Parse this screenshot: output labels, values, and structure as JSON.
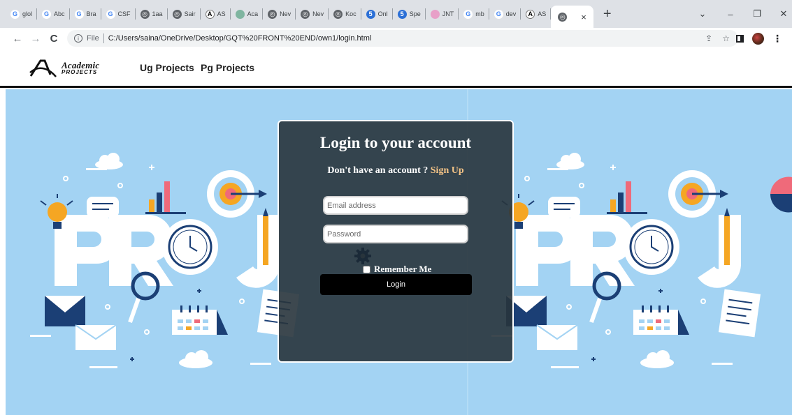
{
  "browser": {
    "tabs": [
      {
        "label": "glol",
        "icon": "google-icon"
      },
      {
        "label": "Abc",
        "icon": "google-icon"
      },
      {
        "label": "Bra",
        "icon": "google-icon"
      },
      {
        "label": "CSF",
        "icon": "google-icon"
      },
      {
        "label": "1aa",
        "icon": "globe-icon"
      },
      {
        "label": "Sair",
        "icon": "globe-icon"
      },
      {
        "label": "AS",
        "icon": "site-a-icon"
      },
      {
        "label": "Aca",
        "icon": "image-icon"
      },
      {
        "label": "Nev",
        "icon": "globe-icon"
      },
      {
        "label": "Nev",
        "icon": "globe-icon"
      },
      {
        "label": "Koc",
        "icon": "globe-icon"
      },
      {
        "label": "Onl",
        "icon": "blue-square-icon"
      },
      {
        "label": "Spe",
        "icon": "blue-square-icon"
      },
      {
        "label": "JNT",
        "icon": "pink-logo-icon"
      },
      {
        "label": "mb",
        "icon": "google-icon"
      },
      {
        "label": "dev",
        "icon": "google-icon"
      },
      {
        "label": "AS",
        "icon": "site-a-icon"
      }
    ],
    "active_tab_close": "×",
    "new_tab": "+",
    "window_controls": {
      "dropdown": "⌄",
      "minimize": "–",
      "restore": "❐",
      "close": "✕"
    },
    "address": {
      "info": "i",
      "scheme": "File",
      "url": "C:/Users/saina/OneDrive/Desktop/GQT%20FRONT%20END/own1/login.html"
    },
    "nav": {
      "back": "←",
      "forward": "→",
      "reload": "C"
    },
    "omni_icons": {
      "share": "⇪",
      "bookmark": "☆"
    },
    "menu": "⋮"
  },
  "site": {
    "logo": {
      "line1": "Academic",
      "line2": "PROJECTS"
    },
    "nav_links": [
      "Ug Projects",
      "Pg Projects"
    ]
  },
  "login": {
    "title": "Login to your account",
    "subtitle": "Don't have an account ?",
    "signup": "Sign Up",
    "email_placeholder": "Email address",
    "password_placeholder": "Password",
    "remember_label": "Remember Me",
    "login_button": "Login"
  },
  "colors": {
    "hero_bg": "#a3d3f3",
    "card_bg": "#28343c",
    "signup_accent": "#f5c486",
    "illustration_navy": "#1b3f75",
    "illustration_orange": "#f5a623",
    "illustration_pink": "#ef6a7a"
  }
}
